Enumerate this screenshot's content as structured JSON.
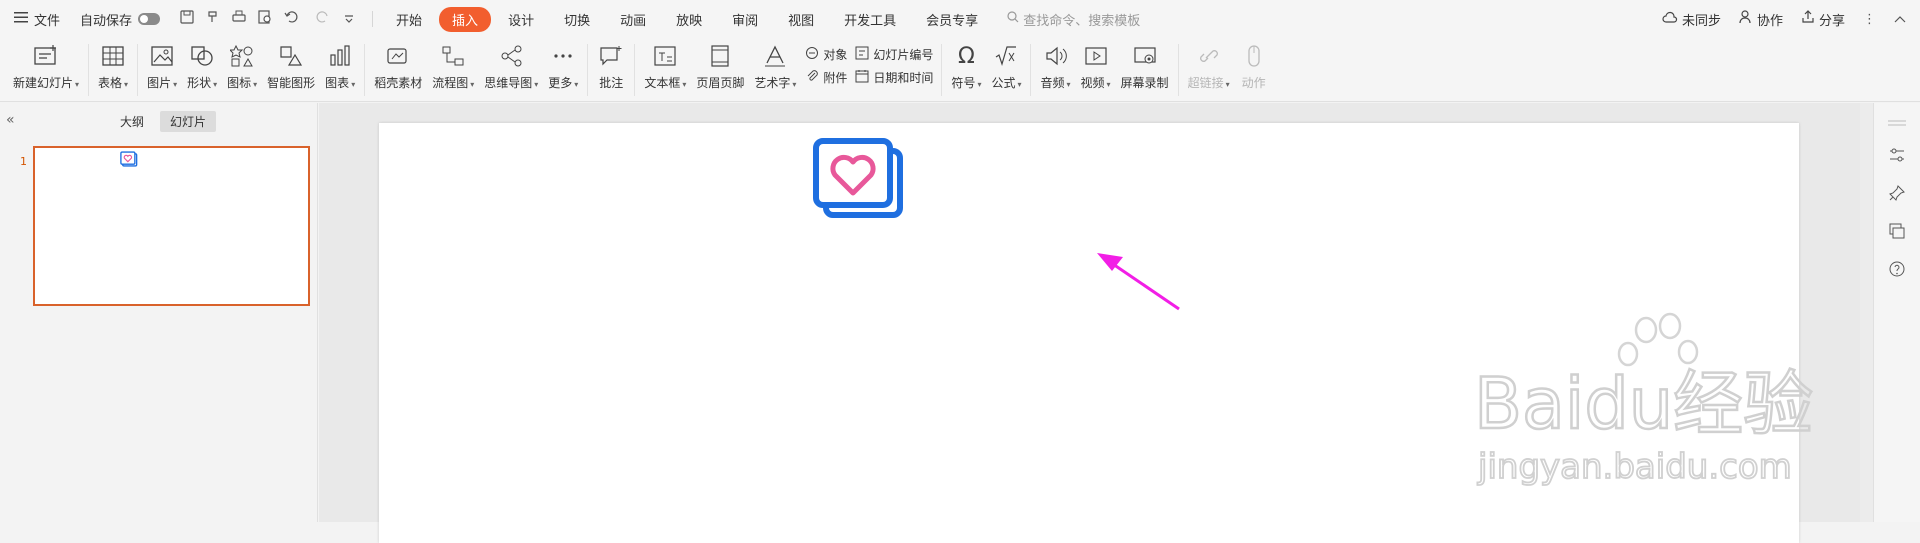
{
  "titlebar": {
    "file_label": "文件",
    "autosave_label": "自动保存",
    "tabs": [
      "开始",
      "插入",
      "设计",
      "切换",
      "动画",
      "放映",
      "审阅",
      "视图",
      "开发工具",
      "会员专享"
    ],
    "active_tab": "插入",
    "search_placeholder": "查找命令、搜索模板",
    "sync_label": "未同步",
    "collab_label": "协作",
    "share_label": "分享"
  },
  "ribbon": {
    "new_slide": "新建幻灯片",
    "table": "表格",
    "picture": "图片",
    "shape": "形状",
    "icon": "图标",
    "smart_graphic": "智能图形",
    "chart": "图表",
    "material": "稻壳素材",
    "flowchart": "流程图",
    "mindmap": "思维导图",
    "more": "更多",
    "comment": "批注",
    "textbox": "文本框",
    "header_footer": "页眉页脚",
    "wordart": "艺术字",
    "object": "对象",
    "attachment": "附件",
    "slide_number": "幻灯片编号",
    "datetime": "日期和时间",
    "symbol": "符号",
    "formula": "公式",
    "audio": "音频",
    "video": "视频",
    "screen_record": "屏幕录制",
    "hyperlink": "超链接",
    "action": "动作"
  },
  "left_panel": {
    "outline_tab": "大纲",
    "slides_tab": "幻灯片",
    "slide_number": "1"
  },
  "watermark": {
    "brand": "Baidu经验",
    "url": "jingyan.baidu.com"
  },
  "colors": {
    "accent": "#f25e2e",
    "thumb_border": "#d9622b",
    "icon_blue": "#1f6fe0",
    "heart_pink": "#e8589a",
    "arrow_magenta": "#f21ee6"
  }
}
